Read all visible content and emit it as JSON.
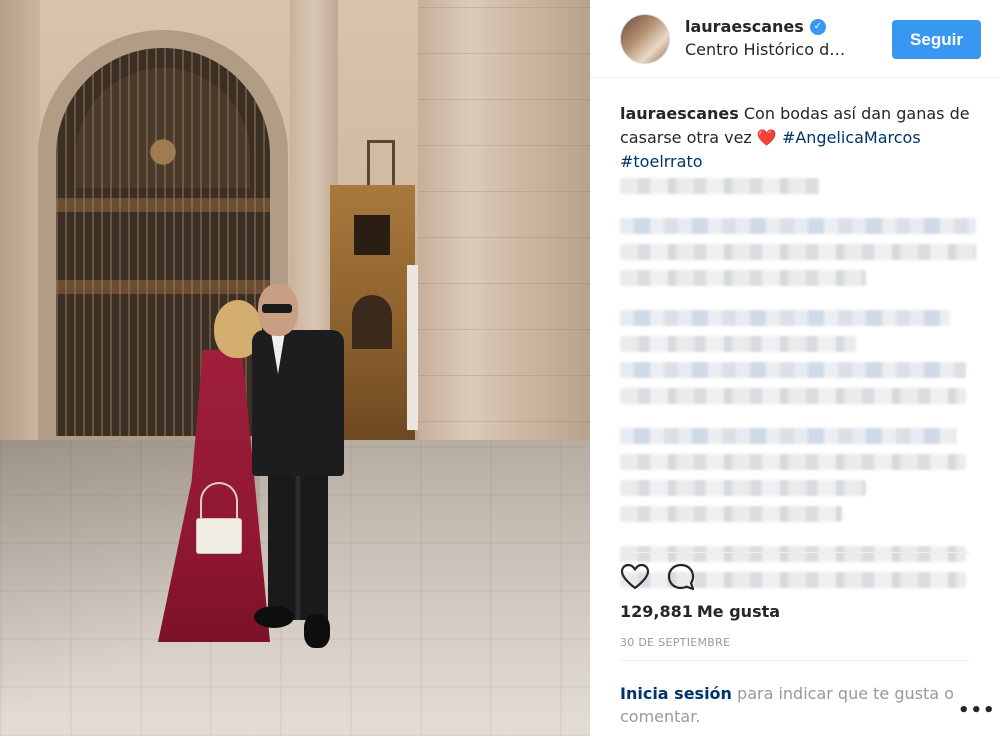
{
  "post": {
    "username": "lauraescanes",
    "verified": true,
    "location": "Centro Histórico d…",
    "follow_label": "Seguir",
    "caption": {
      "username": "lauraescanes",
      "text": "Con bodas así dan ganas de casarse otra vez",
      "emoji": "❤️",
      "hashtags": [
        "#AngelicaMarcos",
        "#toelrrato"
      ]
    },
    "likes": {
      "count": "129,881",
      "label": "Me gusta"
    },
    "date": "30 DE SEPTIEMBRE",
    "login_prompt": {
      "link": "Inicia sesión",
      "rest": "para indicar que te gusta o comentar."
    },
    "more_label": "•••"
  },
  "icons": {
    "like": "heart-outline-icon",
    "comment": "comment-bubble-icon",
    "verified": "verified-badge-icon",
    "more": "more-options-icon"
  },
  "colors": {
    "accent": "#3897f0",
    "link": "#003569",
    "muted": "#999999",
    "text": "#262626",
    "heart": "#e0102f"
  }
}
